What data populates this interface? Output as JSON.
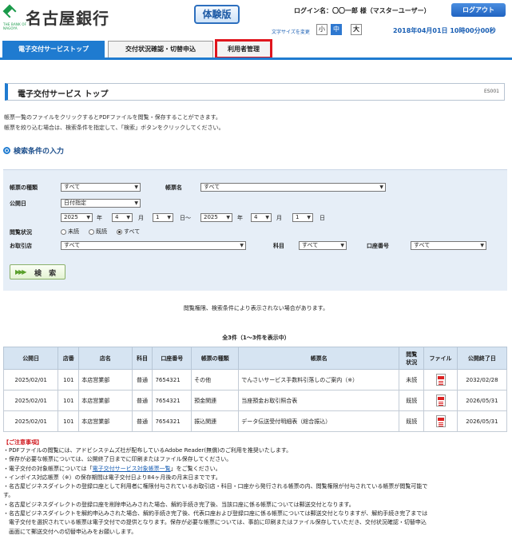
{
  "header": {
    "bank_name": "名古屋銀行",
    "bank_sub": "THE BANK OF NAGOYA",
    "trial_label": "体験版",
    "login_label": "ログイン名：〇〇一郎 様（マスターユーザー）",
    "logout_label": "ログアウト",
    "font_size_label": "文字サイズを変更",
    "font_small": "小",
    "font_mid": "中",
    "font_large": "大",
    "datetime": "2018年04月01日 10時00分00秒",
    "brand_color": "#1f7bd0"
  },
  "tabs": [
    {
      "label": "電子交付サービストップ",
      "active": true
    },
    {
      "label": "交付状況確認・切替申込",
      "active": false
    },
    {
      "label": "利用者管理",
      "active": false,
      "highlighted": true
    }
  ],
  "page": {
    "title": "電子交付サービス トップ",
    "code": "ES001",
    "desc1": "帳票一覧のファイルをクリックするとPDFファイルを閲覧・保存することができます。",
    "desc2": "帳票を絞り込む場合は、検索条件を指定して、「検索」ボタンをクリックしてください。",
    "section_title": "検索条件の入力"
  },
  "search": {
    "doc_type_label": "帳票の種類",
    "doc_type_value": "すべて",
    "doc_name_label": "帳票名",
    "doc_name_value": "すべて",
    "date_label": "公開日",
    "date_mode": "日付指定",
    "from_year": "2025",
    "from_month": "4",
    "from_day": "1",
    "to_year": "2025",
    "to_month": "4",
    "to_day": "1",
    "year_unit": "年",
    "month_unit": "月",
    "day_unit": "日",
    "range_sep": "日～",
    "read_label": "閲覧状況",
    "read_options": [
      "未読",
      "既読",
      "すべて"
    ],
    "read_selected": "すべて",
    "branch_label": "お取引店",
    "branch_value": "すべて",
    "subject_label": "科目",
    "subject_value": "すべて",
    "account_label": "口座番号",
    "account_value": "すべて",
    "search_button": "検 索"
  },
  "notice": "閲覧権限、検索条件により表示されない場合があります。",
  "count_text": "全3件（1～3件を表示中）",
  "table": {
    "headers": [
      "公開日",
      "店番",
      "店名",
      "科目",
      "口座番号",
      "帳票の種類",
      "帳票名",
      "閲覧\n状況",
      "ファイル",
      "公開終了日"
    ],
    "rows": [
      [
        "2025/02/01",
        "101",
        "本店営業部",
        "普通",
        "7654321",
        "その他",
        "でんさいサービス手数料引落しのご案内（※）",
        "未読",
        "2032/02/28"
      ],
      [
        "2025/02/01",
        "101",
        "本店営業部",
        "普通",
        "7654321",
        "預金関連",
        "当座預金お取引照合表",
        "既読",
        "2026/05/31"
      ],
      [
        "2025/02/01",
        "101",
        "本店営業部",
        "普通",
        "7654321",
        "振込関連",
        "データ伝送受付明細表（総合振込）",
        "既読",
        "2026/05/31"
      ]
    ]
  },
  "caution": {
    "title": "【ご注意事項】",
    "lines": [
      "・PDFファイルの閲覧には、アドビシステムズ社が配布しているAdobe Reader(無償)のご利用を推奨いたします。",
      "・保存が必要な帳票については、公開終了日までに印刷またはファイル保存してください。",
      "・電子交付の対象帳票については「",
      "・インボイス対応帳票（※）の保存期間は電子交付日より84ヶ月後の月末日までです。",
      "・名古屋ビジネスダイレクトの登録口座として利用者に権限付与されているお取引店・科目・口座から発行される帳票の内、閲覧権限が付与されている帳票が閲覧可能で",
      "す。",
      "・名古屋ビジネスダイレクトの登録口座を削除申込みされた場合、解約手続き完了後、当該口座に係る帳票については郵送交付となります。",
      "・名古屋ビジネスダイレクトを解約申込みされた場合、解約手続き完了後、代表口座および登録口座に係る帳票については郵送交付となりますが、解約手続き完了までは",
      "　電子交付を選択されている帳票は電子交付での提供となります。保存が必要な帳票については、事前に印刷またはファイル保存していただき、交付状況確認・切替申込",
      "　画面にて郵送交付への切替申込みをお願いします。"
    ],
    "link_text": "電子交付サービス対象帳票一覧",
    "link_suffix": "」をご覧ください。"
  }
}
